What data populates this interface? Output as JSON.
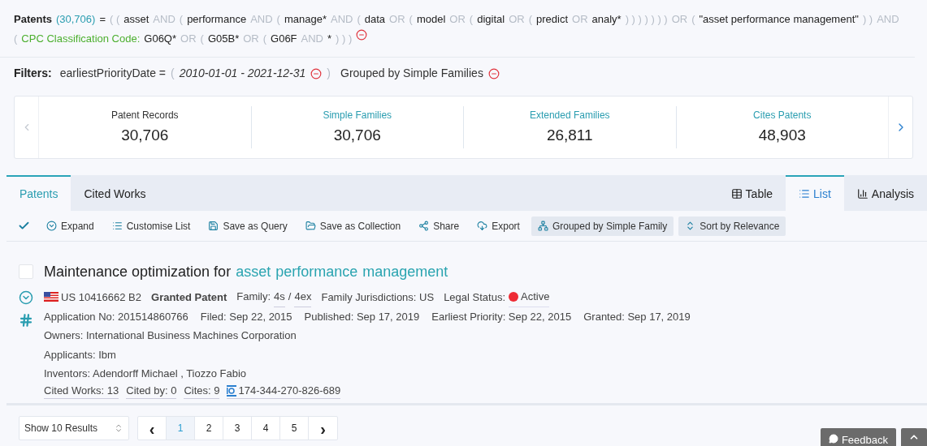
{
  "query": [
    {
      "kind": "label",
      "text": "Patents"
    },
    {
      "kind": "count",
      "text": "(30,706)"
    },
    {
      "kind": "term",
      "text": "="
    },
    {
      "kind": "op",
      "text": "( ("
    },
    {
      "kind": "term",
      "text": "asset"
    },
    {
      "kind": "op",
      "text": "AND"
    },
    {
      "kind": "op",
      "text": "("
    },
    {
      "kind": "term",
      "text": "performance"
    },
    {
      "kind": "op",
      "text": "AND"
    },
    {
      "kind": "op",
      "text": "("
    },
    {
      "kind": "term",
      "text": "manage*"
    },
    {
      "kind": "op",
      "text": "AND"
    },
    {
      "kind": "op",
      "text": "("
    },
    {
      "kind": "term",
      "text": "data"
    },
    {
      "kind": "op",
      "text": "OR"
    },
    {
      "kind": "op",
      "text": "("
    },
    {
      "kind": "term",
      "text": "model"
    },
    {
      "kind": "op",
      "text": "OR"
    },
    {
      "kind": "op",
      "text": "("
    },
    {
      "kind": "term",
      "text": "digital"
    },
    {
      "kind": "op",
      "text": "OR"
    },
    {
      "kind": "op",
      "text": "("
    },
    {
      "kind": "term",
      "text": "predict"
    },
    {
      "kind": "op",
      "text": "OR"
    },
    {
      "kind": "term",
      "text": "analy*"
    },
    {
      "kind": "op",
      "text": ") ) ) ) ) ) )"
    },
    {
      "kind": "op",
      "text": "OR"
    },
    {
      "kind": "op",
      "text": "("
    },
    {
      "kind": "term",
      "text": "\"asset performance management\""
    },
    {
      "kind": "op",
      "text": ") )"
    },
    {
      "kind": "op",
      "text": "AND"
    },
    {
      "kind": "op",
      "text": "("
    },
    {
      "kind": "field",
      "text": "CPC Classification Code:"
    },
    {
      "kind": "term",
      "text": "G06Q*"
    },
    {
      "kind": "op",
      "text": "OR"
    },
    {
      "kind": "op",
      "text": "("
    },
    {
      "kind": "term",
      "text": "G05B*"
    },
    {
      "kind": "op",
      "text": "OR"
    },
    {
      "kind": "op",
      "text": "("
    },
    {
      "kind": "term",
      "text": "G06F"
    },
    {
      "kind": "op",
      "text": "AND"
    },
    {
      "kind": "term",
      "text": "*"
    },
    {
      "kind": "op",
      "text": ") ) )"
    }
  ],
  "filters": {
    "label": "Filters:",
    "field": "earliestPriorityDate =",
    "open": "(",
    "value": "2010-01-01 - 2021-12-31",
    "close": ")",
    "grouping": "Grouped by Simple Families"
  },
  "stats": [
    {
      "label": "Patent Records",
      "value": "30,706",
      "link": false
    },
    {
      "label": "Simple Families",
      "value": "30,706",
      "link": true
    },
    {
      "label": "Extended Families",
      "value": "26,811",
      "link": true
    },
    {
      "label": "Cites Patents",
      "value": "48,903",
      "link": true
    }
  ],
  "tabs": [
    {
      "label": "Patents",
      "selected": true
    },
    {
      "label": "Cited Works",
      "selected": false
    }
  ],
  "views": [
    {
      "label": "Table",
      "selected": false
    },
    {
      "label": "List",
      "selected": true
    },
    {
      "label": "Analysis",
      "selected": false
    }
  ],
  "toolbar": [
    {
      "kind": "check"
    },
    {
      "kind": "action",
      "label": "Expand"
    },
    {
      "kind": "action",
      "label": "Customise List"
    },
    {
      "kind": "action",
      "label": "Save as Query"
    },
    {
      "kind": "action",
      "label": "Save as Collection"
    },
    {
      "kind": "action",
      "label": "Share"
    },
    {
      "kind": "action",
      "label": "Export"
    },
    {
      "kind": "pill",
      "label": "Grouped by Simple Family"
    },
    {
      "kind": "pill",
      "label": "Sort by Relevance"
    }
  ],
  "result": {
    "checked": false,
    "title": [
      {
        "text": "Maintenance optimization for",
        "highlight": false
      },
      {
        "text": "asset",
        "highlight": true
      },
      {
        "text": "performance",
        "highlight": true
      },
      {
        "text": "management",
        "highlight": true
      }
    ],
    "number": "US 10416662 B2",
    "type": "Granted Patent",
    "family_label": "Family:",
    "family_simple": "4s",
    "family_sep": "/",
    "family_ext": "4ex",
    "jurisdictions": "Family Jurisdictions: US",
    "legal_status": {
      "label": "Legal Status:",
      "color": "#ee2b35",
      "value": "Active"
    },
    "dates": [
      "Application No: 201514860766",
      "Filed: Sep 22, 2015",
      "Published: Sep 17, 2019",
      "Earliest Priority: Sep 22, 2015",
      "Granted: Sep 17, 2019"
    ],
    "owners": "Owners: International Business Machines Corporation",
    "applicants": "Applicants: Ibm",
    "inventors": "Inventors: Adendorff Michael , Tiozzo Fabio",
    "links": [
      "Cited Works: 13",
      "Cited by: 0",
      "Cites: 9"
    ],
    "lens_id": "174-344-270-826-689"
  },
  "pagination": {
    "page_size": "Show 10 Results",
    "prev": "‹",
    "next": "›",
    "pages": [
      {
        "label": "1",
        "selected": true
      },
      {
        "label": "2",
        "selected": false
      },
      {
        "label": "3",
        "selected": false
      },
      {
        "label": "4",
        "selected": false
      },
      {
        "label": "5",
        "selected": false
      }
    ]
  },
  "feedback": "Feedback"
}
